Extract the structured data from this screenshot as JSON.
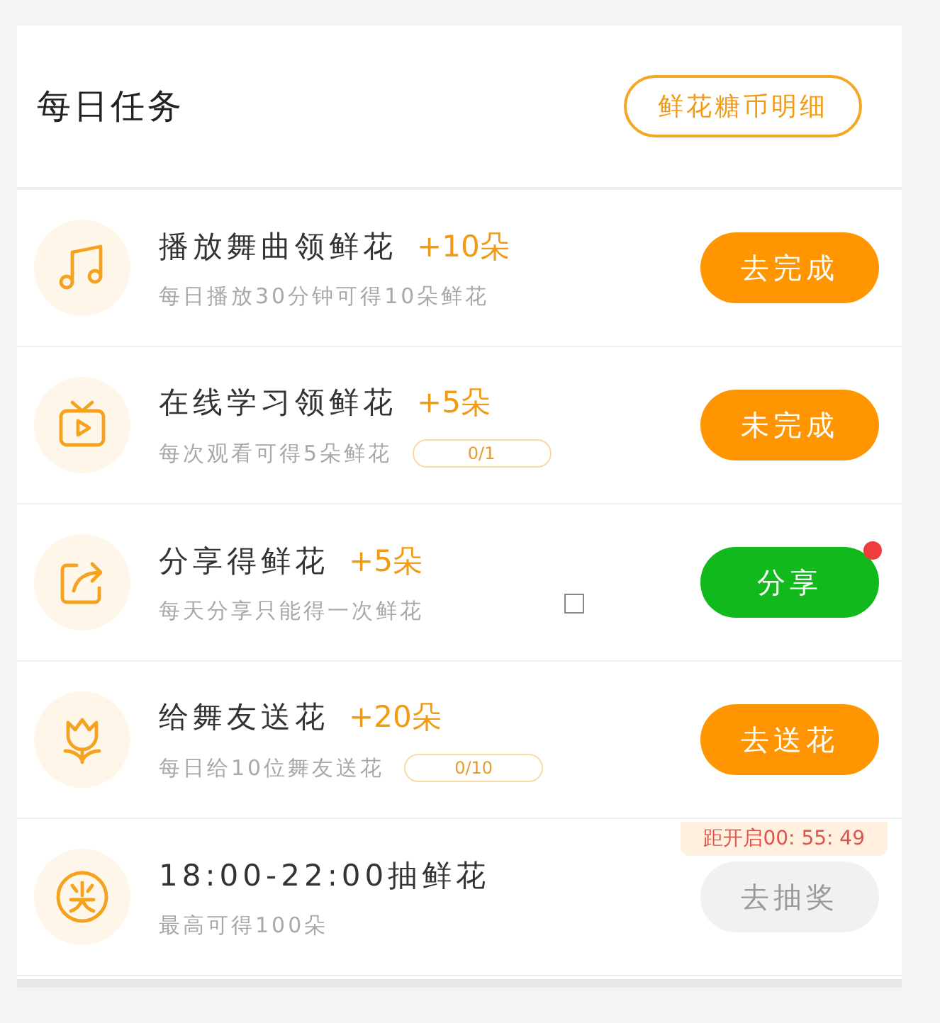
{
  "header": {
    "title": "每日任务",
    "detail_button": "鲜花糖币明细"
  },
  "tasks": [
    {
      "title": "播放舞曲领鲜花",
      "reward": "+10朵",
      "desc": "每日播放30分钟可得10朵鲜花",
      "button": {
        "label": "去完成",
        "kind": "primary"
      }
    },
    {
      "title": "在线学习领鲜花",
      "reward": "+5朵",
      "desc": "每次观看可得5朵鲜花",
      "progress": "0/1",
      "button": {
        "label": "未完成",
        "kind": "primary"
      }
    },
    {
      "title": "分享得鲜花",
      "reward": "+5朵",
      "desc": "每天分享只能得一次鲜花",
      "button": {
        "label": "分享",
        "kind": "share",
        "dot": true
      }
    },
    {
      "title": "给舞友送花",
      "reward": "+20朵",
      "desc": "每日给10位舞友送花",
      "progress": "0/10",
      "button": {
        "label": "去送花",
        "kind": "primary"
      }
    },
    {
      "title": "18:00-22:00抽鲜花",
      "desc": "最高可得100朵",
      "countdown": "距开启00: 55: 49",
      "button": {
        "label": "去抽奖",
        "kind": "disabled"
      }
    }
  ]
}
